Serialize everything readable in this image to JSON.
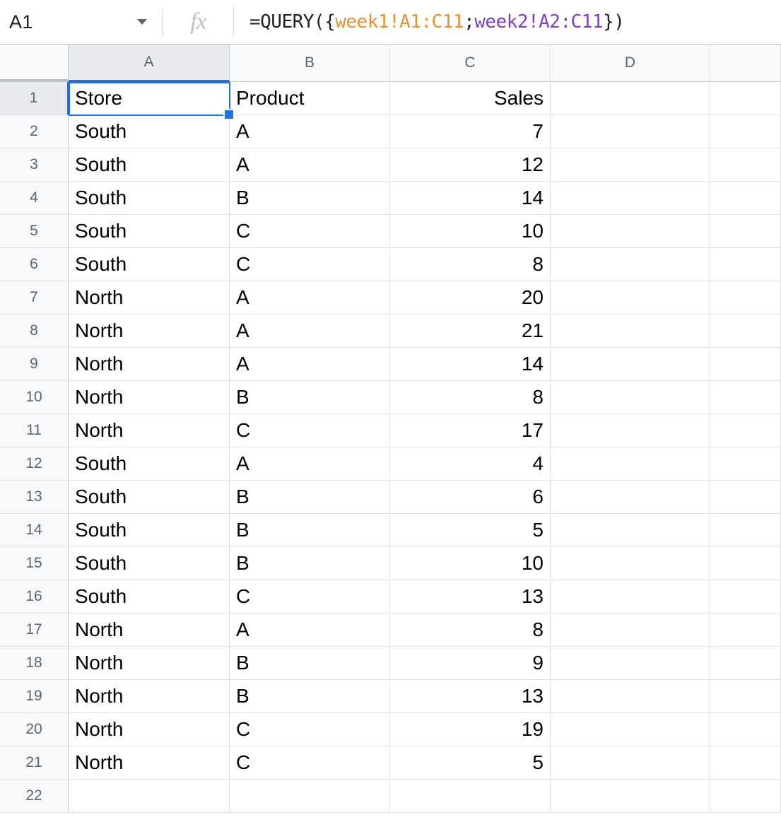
{
  "formula_bar": {
    "name_box_value": "A1",
    "fx_icon_label": "fx",
    "formula_segments": {
      "prefix": "=QUERY({",
      "ref1": "week1!A1:C11",
      "separator": ";",
      "ref2": "week2!A2:C11",
      "suffix": "})"
    },
    "full_formula": "=QUERY({week1!A1:C11;week2!A2:C11})",
    "colors": {
      "ref1": "#e8912d",
      "ref2": "#8140c4",
      "selection": "#1a73e8"
    }
  },
  "grid": {
    "column_headers": [
      "A",
      "B",
      "C",
      "D",
      ""
    ],
    "selected_cell": "A1",
    "selected_column": "A",
    "selected_row": "1",
    "row_numbers": [
      "1",
      "2",
      "3",
      "4",
      "5",
      "6",
      "7",
      "8",
      "9",
      "10",
      "11",
      "12",
      "13",
      "14",
      "15",
      "16",
      "17",
      "18",
      "19",
      "20",
      "21",
      "22"
    ],
    "headers": {
      "a": "Store",
      "b": "Product",
      "c": "Sales"
    },
    "rows": [
      {
        "n": "1",
        "store": "Store",
        "product": "Product",
        "sales": "Sales"
      },
      {
        "n": "2",
        "store": "South",
        "product": "A",
        "sales": "7"
      },
      {
        "n": "3",
        "store": "South",
        "product": "A",
        "sales": "12"
      },
      {
        "n": "4",
        "store": "South",
        "product": "B",
        "sales": "14"
      },
      {
        "n": "5",
        "store": "South",
        "product": "C",
        "sales": "10"
      },
      {
        "n": "6",
        "store": "South",
        "product": "C",
        "sales": "8"
      },
      {
        "n": "7",
        "store": "North",
        "product": "A",
        "sales": "20"
      },
      {
        "n": "8",
        "store": "North",
        "product": "A",
        "sales": "21"
      },
      {
        "n": "9",
        "store": "North",
        "product": "A",
        "sales": "14"
      },
      {
        "n": "10",
        "store": "North",
        "product": "B",
        "sales": "8"
      },
      {
        "n": "11",
        "store": "North",
        "product": "C",
        "sales": "17"
      },
      {
        "n": "12",
        "store": "South",
        "product": "A",
        "sales": "4"
      },
      {
        "n": "13",
        "store": "South",
        "product": "B",
        "sales": "6"
      },
      {
        "n": "14",
        "store": "South",
        "product": "B",
        "sales": "5"
      },
      {
        "n": "15",
        "store": "South",
        "product": "B",
        "sales": "10"
      },
      {
        "n": "16",
        "store": "South",
        "product": "C",
        "sales": "13"
      },
      {
        "n": "17",
        "store": "North",
        "product": "A",
        "sales": "8"
      },
      {
        "n": "18",
        "store": "North",
        "product": "B",
        "sales": "9"
      },
      {
        "n": "19",
        "store": "North",
        "product": "B",
        "sales": "13"
      },
      {
        "n": "20",
        "store": "North",
        "product": "C",
        "sales": "19"
      },
      {
        "n": "21",
        "store": "North",
        "product": "C",
        "sales": "5"
      },
      {
        "n": "22",
        "store": "",
        "product": "",
        "sales": ""
      }
    ]
  }
}
